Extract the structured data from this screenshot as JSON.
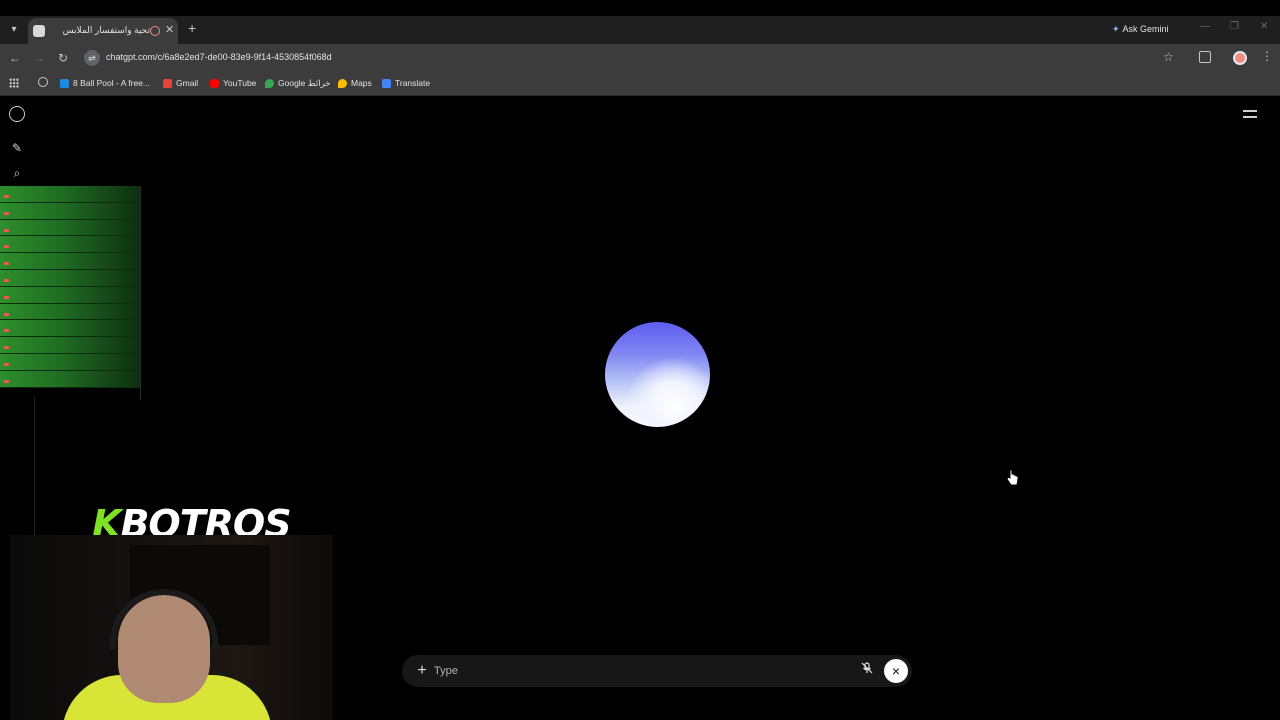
{
  "browser": {
    "tab": {
      "title": "تحية واستفسار الملابس"
    },
    "new_tab_symbol": "+",
    "ask_gemini": "Ask Gemini",
    "url": "chatgpt.com/c/6a8e2ed7-de00-83e9-9f14-4530854f068d",
    "bookmarks": [
      {
        "label": "8 Ball Pool - A free...",
        "icon": "8ball-icon",
        "color": "#1e88e5"
      },
      {
        "label": "Gmail",
        "icon": "gmail-icon",
        "color": "#ea4335"
      },
      {
        "label": "YouTube",
        "icon": "youtube-icon",
        "color": "#ff0000"
      },
      {
        "label": "Google خرائط",
        "icon": "maps-icon",
        "color": "#34a853"
      },
      {
        "label": "Maps",
        "icon": "maps-icon",
        "color": "#fbbc04"
      },
      {
        "label": "Translate",
        "icon": "translate-icon",
        "color": "#4285f4"
      }
    ]
  },
  "composer": {
    "placeholder": "Type",
    "plus_symbol": "+",
    "end_symbol": "×"
  },
  "overlay": {
    "brand_k": "K",
    "brand_rest": "BOTROS"
  },
  "colors": {
    "orb_top": "#5e5ef0",
    "orb_bottom": "#ffffff",
    "chat_list_green": "#2c8f2c",
    "brand_accent": "#7ee322"
  }
}
